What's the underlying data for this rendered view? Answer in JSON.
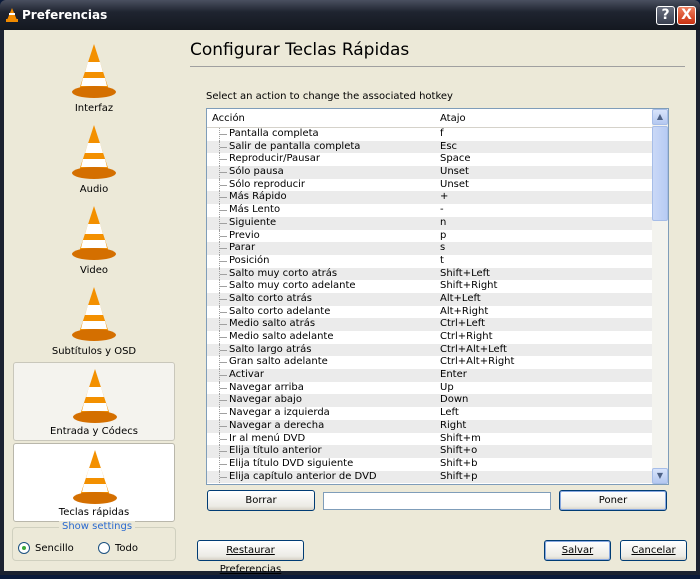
{
  "window": {
    "title": "Preferencias",
    "help": "?",
    "close": "X"
  },
  "sidebar": {
    "items": [
      {
        "label": "Interfaz",
        "icon": "vlc-cone-interface-icon"
      },
      {
        "label": "Audio",
        "icon": "vlc-cone-headphones-icon"
      },
      {
        "label": "Video",
        "icon": "vlc-cone-glasses-icon"
      },
      {
        "label": "Subtítulos y OSD",
        "icon": "vlc-cone-clock-icon"
      },
      {
        "label": "Entrada y Códecs",
        "icon": "vlc-cone-cable-icon"
      },
      {
        "label": "Teclas rápidas",
        "icon": "vlc-cone-keyboard-icon"
      }
    ],
    "selected": "Teclas rápidas",
    "show_settings": {
      "title": "Show settings",
      "options": [
        "Sencillo",
        "Todo"
      ],
      "selected": "Sencillo"
    }
  },
  "main": {
    "title": "Configurar Teclas Rápidas",
    "hint": "Select an action to change the associated hotkey",
    "columns": [
      "Acción",
      "Atajo"
    ],
    "rows": [
      [
        "Pantalla completa",
        "f"
      ],
      [
        "Salir de pantalla completa",
        "Esc"
      ],
      [
        "Reproducir/Pausar",
        "Space"
      ],
      [
        "Sólo pausa",
        "Unset"
      ],
      [
        "Sólo reproducir",
        "Unset"
      ],
      [
        "Más Rápido",
        "+"
      ],
      [
        "Más Lento",
        "-"
      ],
      [
        "Siguiente",
        "n"
      ],
      [
        "Previo",
        "p"
      ],
      [
        "Parar",
        "s"
      ],
      [
        "Posición",
        "t"
      ],
      [
        "Salto muy corto atrás",
        "Shift+Left"
      ],
      [
        "Salto muy corto adelante",
        "Shift+Right"
      ],
      [
        "Salto corto atrás",
        "Alt+Left"
      ],
      [
        "Salto corto adelante",
        "Alt+Right"
      ],
      [
        "Medio salto atrás",
        "Ctrl+Left"
      ],
      [
        "Medio salto adelante",
        "Ctrl+Right"
      ],
      [
        "Salto largo atrás",
        "Ctrl+Alt+Left"
      ],
      [
        "Gran salto adelante",
        "Ctrl+Alt+Right"
      ],
      [
        "Activar",
        "Enter"
      ],
      [
        "Navegar arriba",
        "Up"
      ],
      [
        "Navegar abajo",
        "Down"
      ],
      [
        "Navegar a izquierda",
        "Left"
      ],
      [
        "Navegar a derecha",
        "Right"
      ],
      [
        "Ir al menú DVD",
        "Shift+m"
      ],
      [
        "Elija título anterior",
        "Shift+o"
      ],
      [
        "Elija título DVD siguiente",
        "Shift+b"
      ],
      [
        "Elija capítulo anterior de DVD",
        "Shift+p"
      ]
    ],
    "clear_label": "Borrar",
    "hotkey_value": "",
    "set_label": "Poner"
  },
  "footer": {
    "reset_label": "Restaurar Preferencias",
    "save_label": "Salvar",
    "cancel_label": "Cancelar"
  }
}
